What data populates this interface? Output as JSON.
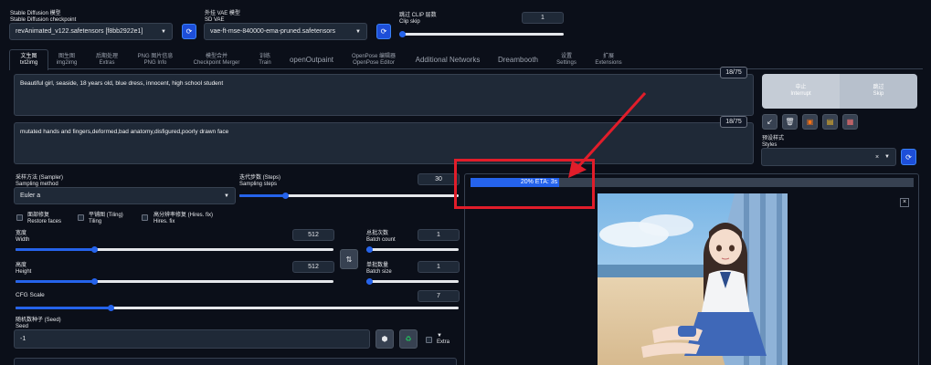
{
  "top": {
    "checkpoint_label_cn": "Stable Diffusion 模型",
    "checkpoint_label_en": "Stable Diffusion checkpoint",
    "checkpoint_value": "revAnimated_v122.safetensors [f8bb2922e1]",
    "vae_label_cn": "外挂 VAE 模型",
    "vae_label_en": "SD VAE",
    "vae_value": "vae-ft-mse-840000-ema-pruned.safetensors",
    "clip_label_cn": "跳过 CLIP 层数",
    "clip_label_en": "Clip skip",
    "clip_value": "1",
    "refresh_icon": "refresh-icon"
  },
  "tabs": [
    {
      "cn": "文生图",
      "en": "txt2img"
    },
    {
      "cn": "图生图",
      "en": "img2img"
    },
    {
      "cn": "后期处理",
      "en": "Extras"
    },
    {
      "cn": "PNG 图片信息",
      "en": "PNG Info"
    },
    {
      "cn": "模型合并",
      "en": "Checkpoint Merger"
    },
    {
      "cn": "训练",
      "en": "Train"
    },
    {
      "cn": "openOutpaint",
      "en": ""
    },
    {
      "cn": "OpenPose 编辑器",
      "en": "OpenPose Editor"
    },
    {
      "cn": "Additional Networks",
      "en": ""
    },
    {
      "cn": "Dreambooth",
      "en": ""
    },
    {
      "cn": "设置",
      "en": "Settings"
    },
    {
      "cn": "扩展",
      "en": "Extensions"
    }
  ],
  "prompt": {
    "positive": "Beautiful girl, seaside, 18 years old, blue dress, innocent, high school student",
    "positive_count": "18/75",
    "negative": "mutated hands and fingers,deformed,bad anatomy,disfigured,poorly drawn face",
    "negative_count": "18/75"
  },
  "actions": {
    "interrupt_cn": "中止",
    "interrupt_en": "Interrupt",
    "skip_cn": "跳过",
    "skip_en": "Skip",
    "styles_label_cn": "预设样式",
    "styles_label_en": "Styles",
    "styles_clear": "×"
  },
  "params": {
    "sampler_label_cn": "采样方法 (Sampler)",
    "sampler_label_en": "Sampling method",
    "sampler_value": "Euler a",
    "steps_label_cn": "迭代步数 (Steps)",
    "steps_label_en": "Sampling steps",
    "steps_value": "30",
    "restore_cn": "面部修复",
    "restore_en": "Restore faces",
    "tiling_cn": "平铺图 (Tiling)",
    "tiling_en": "Tiling",
    "hires_cn": "高分辨率修复 (Hires. fix)",
    "hires_en": "Hires. fix",
    "width_cn": "宽度",
    "width_en": "Width",
    "width_value": "512",
    "height_cn": "高度",
    "height_en": "Height",
    "height_value": "512",
    "batch_count_cn": "总批次数",
    "batch_count_en": "Batch count",
    "batch_count_value": "1",
    "batch_size_cn": "单批数量",
    "batch_size_en": "Batch size",
    "batch_size_value": "1",
    "cfg_label": "CFG Scale",
    "cfg_value": "7",
    "seed_label_cn": "随机数种子 (Seed)",
    "seed_label_en": "Seed",
    "seed_value": "-1",
    "extra_label": "Extra",
    "swap_icon": "⇅"
  },
  "output": {
    "progress_text": "20% ETA: 3s",
    "progress_fraction": 0.2,
    "close": "×"
  },
  "colors": {
    "accent": "#2563eb",
    "annotation": "#e11d2a",
    "background": "#0b0f19"
  }
}
